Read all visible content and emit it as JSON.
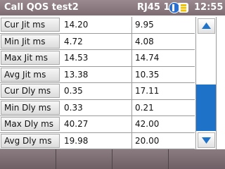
{
  "header": {
    "title": "Call QOS  test2",
    "port": "RJ45 100",
    "battery_icon": "battery-status-icon",
    "time": "12:55"
  },
  "table": {
    "rows": [
      {
        "label": "Cur Jit ms",
        "col1": "14.20",
        "col2": "9.95"
      },
      {
        "label": "Min Jit ms",
        "col1": "4.72",
        "col2": "4.08"
      },
      {
        "label": "Max Jit ms",
        "col1": "14.53",
        "col2": "14.74"
      },
      {
        "label": "Avg Jit ms",
        "col1": "13.38",
        "col2": "10.35"
      },
      {
        "label": "Cur Dly ms",
        "col1": "0.35",
        "col2": "17.11"
      },
      {
        "label": "Min Dly ms",
        "col1": "0.33",
        "col2": "0.21"
      },
      {
        "label": "Max Dly ms",
        "col1": "40.27",
        "col2": "42.00"
      },
      {
        "label": "Avg Dly ms",
        "col1": "19.98",
        "col2": "20.00"
      }
    ]
  },
  "scrollbar": {
    "up_icon": "arrow-up-icon",
    "down_icon": "arrow-down-icon",
    "position_fraction": 0.55,
    "color": "#1e73c8"
  },
  "softkeys": [
    "",
    "",
    "",
    ""
  ],
  "colors": {
    "titlebar": "#8a7a80",
    "accent": "#1e73c8",
    "battery_accent": "#f2c200"
  }
}
